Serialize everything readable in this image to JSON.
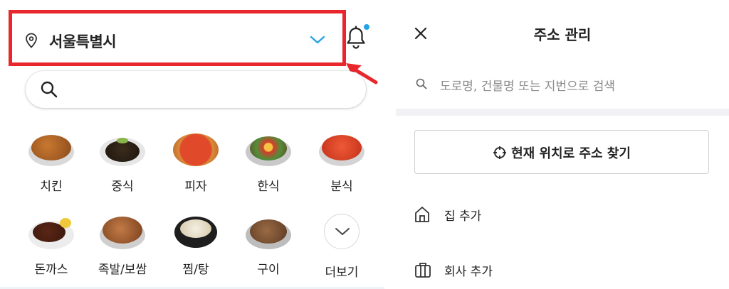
{
  "location": {
    "label": "서울특별시",
    "icons": {
      "pin": "location-pin-icon",
      "chevron": "chevron-down-icon",
      "bell": "bell-icon"
    },
    "highlight_color": "#e8262c",
    "accent_color": "#25a3e8"
  },
  "search": {
    "icon": "search-icon"
  },
  "categories": [
    {
      "label": "치킨",
      "icon": "chicken-food-image"
    },
    {
      "label": "중식",
      "icon": "chinese-food-image"
    },
    {
      "label": "피자",
      "icon": "pizza-food-image"
    },
    {
      "label": "한식",
      "icon": "korean-food-image"
    },
    {
      "label": "분식",
      "icon": "snack-food-image"
    },
    {
      "label": "돈까스",
      "icon": "pork-cutlet-food-image"
    },
    {
      "label": "족발/보쌈",
      "icon": "jokbal-food-image"
    },
    {
      "label": "찜/탕",
      "icon": "stew-food-image"
    },
    {
      "label": "구이",
      "icon": "grill-food-image"
    },
    {
      "label": "더보기",
      "icon": "chevron-down-icon"
    }
  ],
  "address_panel": {
    "title": "주소 관리",
    "close_icon": "close-icon",
    "search_placeholder": "도로명, 건물명 또는 지번으로 검색",
    "current_location_button": "현재 위치로 주소 찾기",
    "home_add": "집 추가",
    "work_add": "회사 추가"
  }
}
